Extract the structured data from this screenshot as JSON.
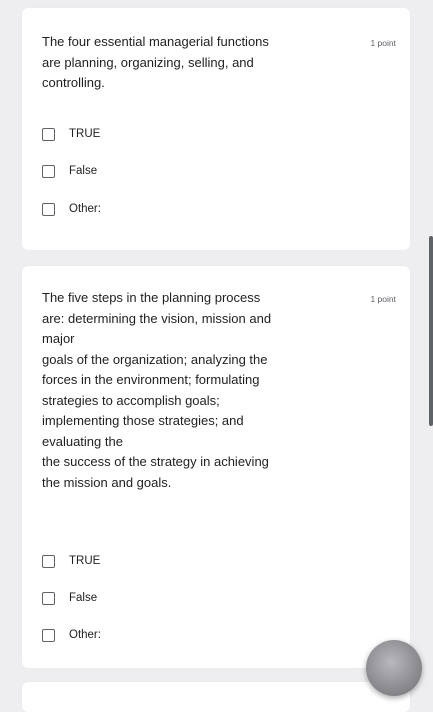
{
  "questions": [
    {
      "text_lines": [
        "The four essential managerial functions",
        "are planning, organizing, selling, and",
        "controlling."
      ],
      "points": "1 point",
      "options": [
        "TRUE",
        "False",
        "Other:"
      ]
    },
    {
      "text_lines": [
        "The five steps in the planning process",
        "are: determining the vision, mission and",
        "major",
        "goals of the organization; analyzing the",
        "forces in the environment; formulating",
        "strategies to accomplish goals;",
        "implementing those strategies; and",
        "evaluating the",
        "the success of the strategy in achieving",
        "the mission and goals."
      ],
      "points": "1 point",
      "options": [
        "TRUE",
        "False",
        "Other:"
      ]
    }
  ]
}
